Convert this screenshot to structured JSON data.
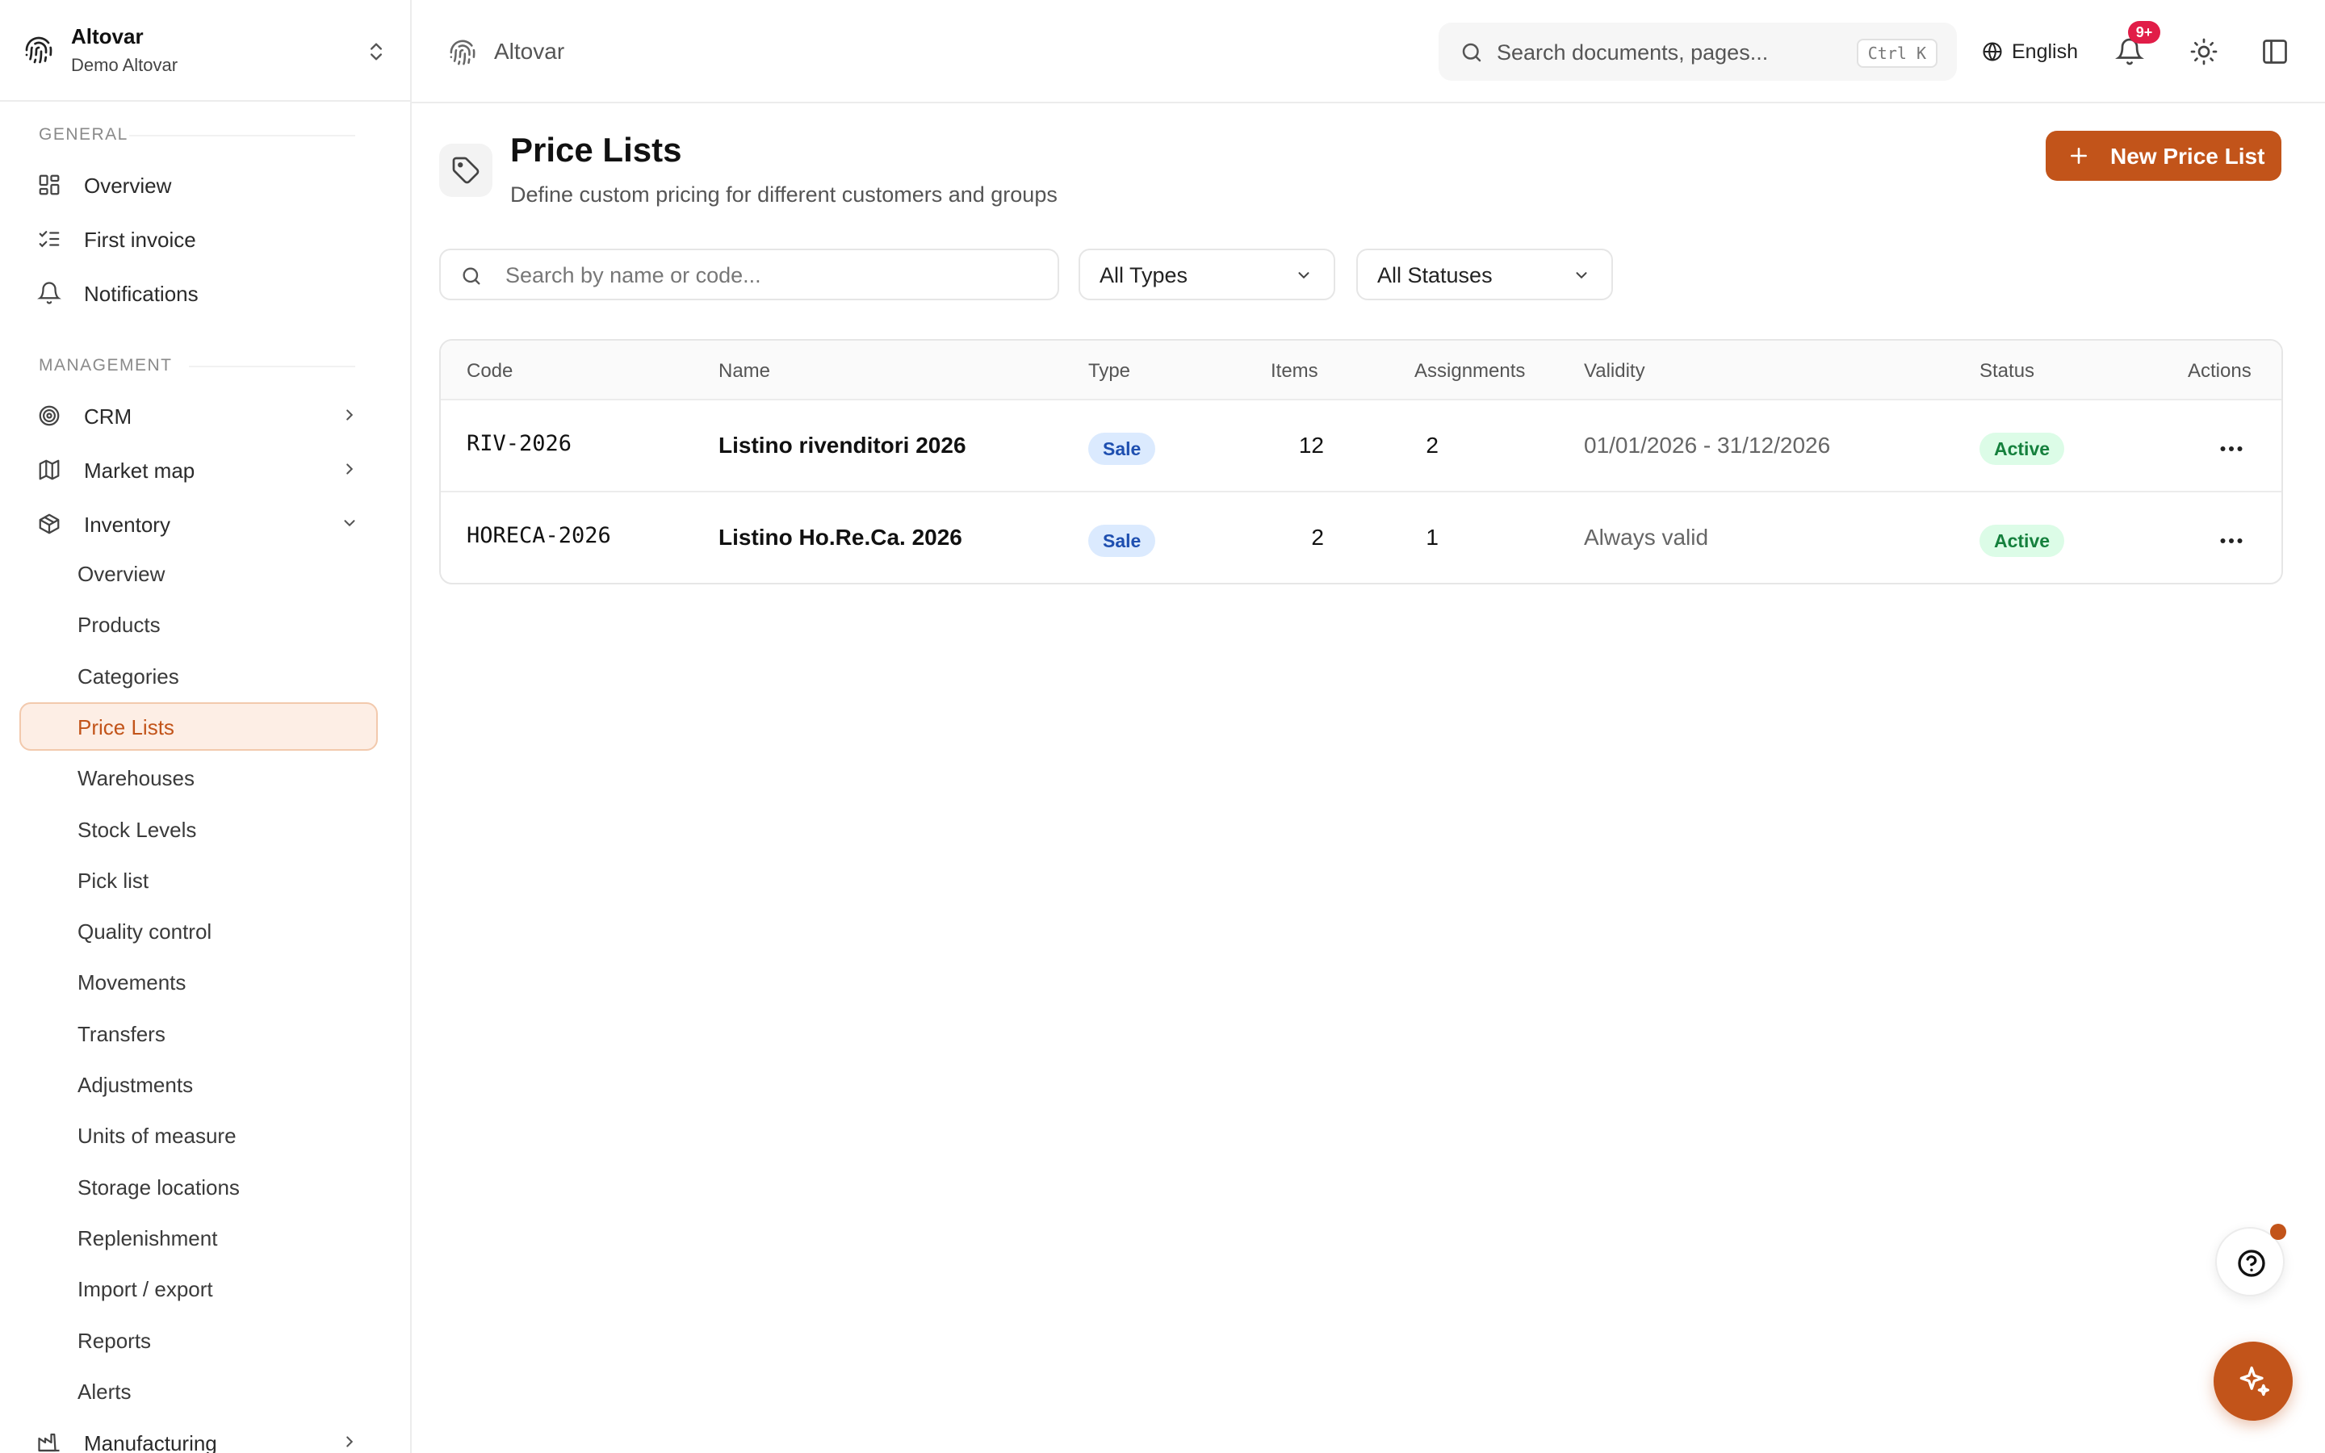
{
  "org": {
    "name": "Altovar",
    "subtitle": "Demo Altovar"
  },
  "sidebar": {
    "general_label": "GENERAL",
    "general_items": [
      {
        "label": "Overview",
        "icon": "dashboard-icon"
      },
      {
        "label": "First invoice",
        "icon": "checklist-icon"
      },
      {
        "label": "Notifications",
        "icon": "bell-icon"
      }
    ],
    "management_label": "MANAGEMENT",
    "management_items": [
      {
        "label": "CRM",
        "icon": "target-icon"
      },
      {
        "label": "Market map",
        "icon": "map-icon"
      },
      {
        "label": "Inventory",
        "icon": "box-icon",
        "expanded": true
      }
    ],
    "inventory_sub": [
      "Overview",
      "Products",
      "Categories",
      "Price Lists",
      "Warehouses",
      "Stock Levels",
      "Pick list",
      "Quality control",
      "Movements",
      "Transfers",
      "Adjustments",
      "Units of measure",
      "Storage locations",
      "Replenishment",
      "Import / export",
      "Reports",
      "Alerts"
    ],
    "active_sub": "Price Lists",
    "after_items": [
      {
        "label": "Manufacturing",
        "icon": "factory-icon"
      }
    ]
  },
  "topbar": {
    "breadcrumb": "Altovar",
    "search_placeholder": "Search documents, pages...",
    "search_shortcut": "Ctrl K",
    "language": "English",
    "notif_badge": "9+"
  },
  "page": {
    "title": "Price Lists",
    "subtitle": "Define custom pricing for different customers and groups",
    "new_button": "New Price List",
    "search_placeholder": "Search by name or code...",
    "type_filter": "All Types",
    "status_filter": "All Statuses"
  },
  "table": {
    "columns": [
      "Code",
      "Name",
      "Type",
      "Items",
      "Assignments",
      "Validity",
      "Status",
      "Actions"
    ],
    "rows": [
      {
        "code": "RIV-2026",
        "name": "Listino rivenditori 2026",
        "type": "Sale",
        "items": "12",
        "assignments": "2",
        "validity": "01/01/2026 - 31/12/2026",
        "status": "Active"
      },
      {
        "code": "HORECA-2026",
        "name": "Listino Ho.Re.Ca. 2026",
        "type": "Sale",
        "items": "2",
        "assignments": "1",
        "validity": "Always valid",
        "status": "Active"
      }
    ]
  },
  "colors": {
    "accent": "#c2541a",
    "active_bg": "#fdeee5",
    "sale_badge": "#dbeafe",
    "active_badge": "#dcfce7"
  }
}
